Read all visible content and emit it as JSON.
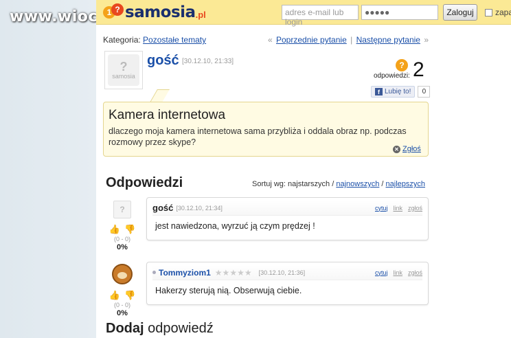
{
  "watermark": "www.wiocha.pl",
  "header": {
    "logo_badge_1": "1",
    "logo_badge_2": "?",
    "logo_text": "samosia",
    "logo_tld": ".pl",
    "email_placeholder": "adres e-mail lub login",
    "password_value": "●●●●●",
    "login_button": "Zaloguj",
    "remember_label": "zapamiętaj"
  },
  "category": {
    "label": "Kategoria:",
    "value": "Pozostałe tematy"
  },
  "nav": {
    "prev_arrow": "«",
    "prev": "Poprzednie pytanie",
    "sep": "|",
    "next": "Następne pytanie",
    "next_arrow": "»"
  },
  "question": {
    "user": "gość",
    "date": "[30.12.10, 21:33]",
    "answers_label": "odpowiedzi:",
    "answers_count": "2",
    "like_label": "Lubię to!",
    "like_count": "0",
    "title": "Kamera internetowa",
    "body": "dlaczego moja kamera internetowa sama przybliża i oddala obraz np. podczas rozmowy przez skype?",
    "report": "Zgłoś",
    "avatar_text": "samosia"
  },
  "answers_section": {
    "heading": "Odpowiedzi",
    "sort_label": "Sortuj wg:",
    "sort_oldest": "najstarszych",
    "sort_sep": "/",
    "sort_newest": "najnowszych",
    "sort_best": "najlepszych"
  },
  "answers": [
    {
      "user": "gość",
      "date": "[30.12.10, 21:34]",
      "text": "jest nawiedzona, wyrzuć ją czym prędzej !",
      "quote": "cytuj",
      "link": "link",
      "report": "zgłoś",
      "votes": "(0 - 0)",
      "pct": "0%"
    },
    {
      "user": "Tommyziom1",
      "stars": "★★★★★",
      "date": "[30.12.10, 21:36]",
      "text": "Hakerzy sterują nią. Obserwują ciebie.",
      "quote": "cytuj",
      "link": "link",
      "report": "zgłoś",
      "votes": "(0 - 0)",
      "pct": "0%"
    }
  ],
  "add_answer": {
    "bold": "Dodaj",
    "rest": "odpowiedź"
  },
  "colors": {
    "topbar": "#fbe995",
    "link": "#1a4fa8",
    "question_bg": "#fffbe3",
    "logo_orange": "#f4a21a",
    "logo_red": "#e8481e"
  }
}
